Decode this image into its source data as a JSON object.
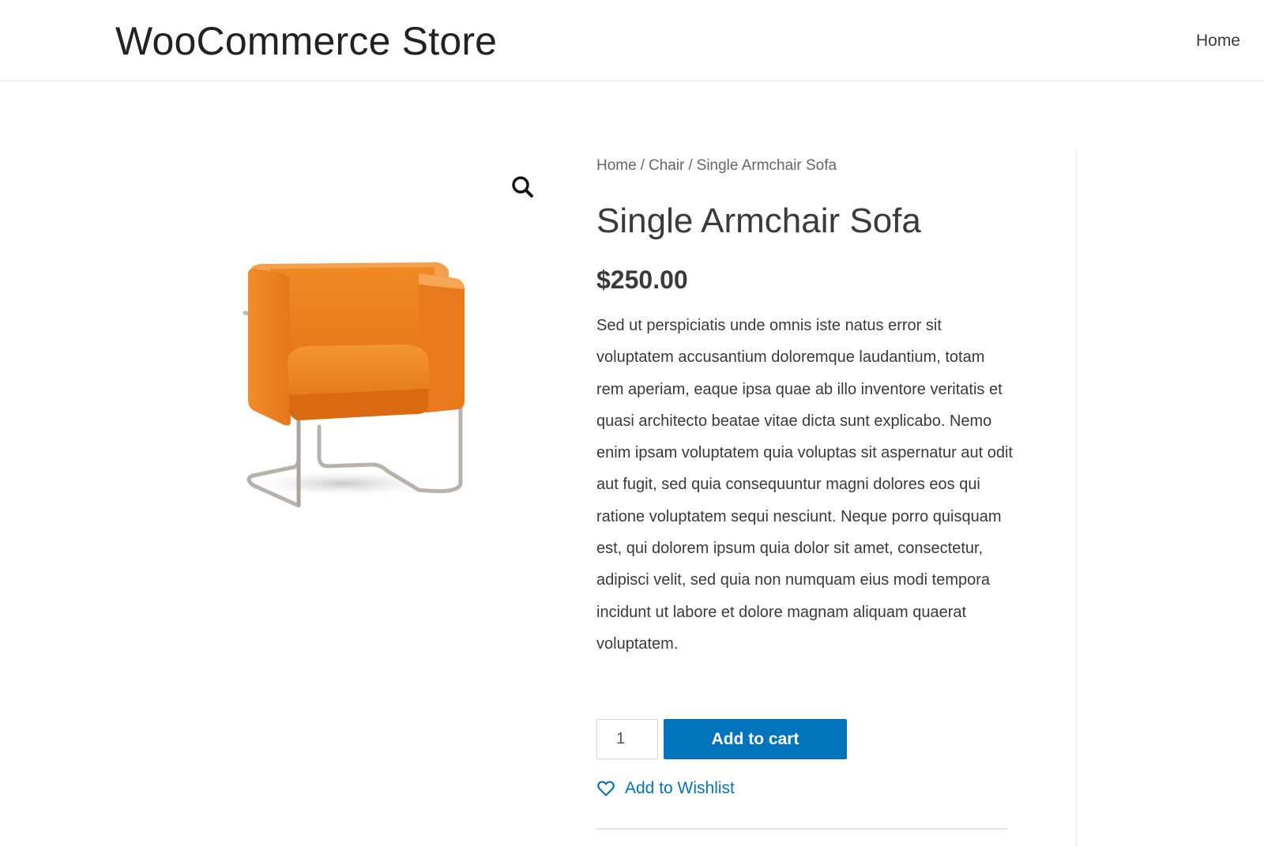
{
  "header": {
    "site_title": "WooCommerce Store",
    "nav": [
      {
        "label": "Home"
      }
    ]
  },
  "breadcrumb": {
    "items": [
      "Home",
      "Chair",
      "Single Armchair Sofa"
    ],
    "separator": "/"
  },
  "product": {
    "title": "Single Armchair Sofa",
    "price": "$250.00",
    "description": "Sed ut perspiciatis unde omnis iste natus error sit voluptatem accusantium doloremque laudantium, totam rem aperiam, eaque ipsa quae ab illo inventore veritatis et quasi architecto beatae vitae dicta sunt explicabo. Nemo enim ipsam voluptatem quia voluptas sit aspernatur aut odit aut fugit, sed quia consequuntur magni dolores eos qui ratione voluptatem sequi nesciunt. Neque porro quisquam est, qui dolorem ipsum quia dolor sit amet, consectetur, adipisci velit, sed quia non numquam eius modi tempora incidunt ut labore et dolore magnam aliquam quaerat voluptatem.",
    "image_icon": "orange-armchair-image",
    "zoom_icon": "search-icon"
  },
  "cart": {
    "quantity": "1",
    "add_to_cart_label": "Add to cart"
  },
  "wishlist": {
    "label": "Add to Wishlist",
    "icon": "heart-icon"
  },
  "colors": {
    "accent": "#0274be",
    "text": "#3a3a3a",
    "product_orange": "#f0841e"
  }
}
